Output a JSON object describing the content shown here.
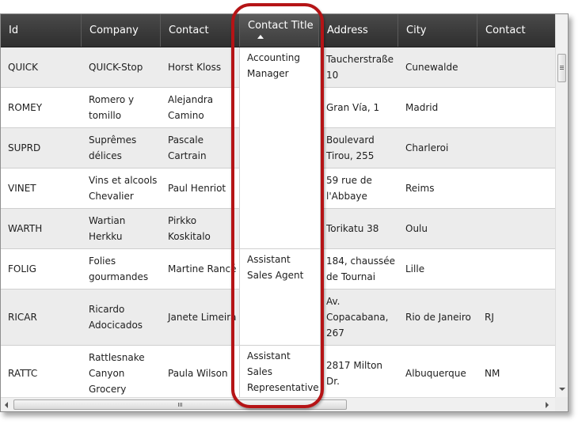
{
  "columns": [
    "Id",
    "Company",
    "Contact",
    "Contact Title",
    "Address",
    "City",
    "Contact"
  ],
  "rows": [
    {
      "id": "QUICK",
      "company": "QUICK-Stop",
      "contact": "Horst Kloss",
      "address": "Taucherstraße\n10",
      "city": "Cunewalde",
      "region": ""
    },
    {
      "id": "ROMEY",
      "company": "Romero y\ntomillo",
      "contact": "Alejandra\nCamino",
      "address": "Gran Vía, 1",
      "city": "Madrid",
      "region": ""
    },
    {
      "id": "SUPRD",
      "company": "Suprêmes\ndélices",
      "contact": "Pascale\nCartrain",
      "address": "Boulevard\nTirou, 255",
      "city": "Charleroi",
      "region": ""
    },
    {
      "id": "VINET",
      "company": "Vins et alcools\nChevalier",
      "contact": "Paul Henriot",
      "address": "59 rue de\nl'Abbaye",
      "city": "Reims",
      "region": ""
    },
    {
      "id": "WARTH",
      "company": "Wartian\nHerkku",
      "contact": "Pirkko\nKoskitalo",
      "address": "Torikatu 38",
      "city": "Oulu",
      "region": ""
    },
    {
      "id": "FOLIG",
      "company": "Folies\ngourmandes",
      "contact": "Martine Rancé",
      "address": "184, chaussée\nde Tournai",
      "city": "Lille",
      "region": ""
    },
    {
      "id": "RICAR",
      "company": "Ricardo\nAdocicados",
      "contact": "Janete Limeira",
      "address": "Av.\nCopacabana,\n267",
      "city": "Rio de Janeiro",
      "region": "RJ"
    },
    {
      "id": "RATTC",
      "company": "Rattlesnake\nCanyon\nGrocery",
      "contact": "Paula Wilson",
      "address": "2817 Milton\nDr.",
      "city": "Albuquerque",
      "region": "NM"
    }
  ],
  "title_groups": [
    "Accounting\nManager",
    "Assistant\nSales Agent",
    "Assistant\nSales\nRepresentative"
  ],
  "colors": {
    "header_bg": "#3a3a3a",
    "alt_row": "#ececec",
    "highlight_ring": "#b51416"
  },
  "sort": {
    "column": "Contact Title",
    "direction": "ascending"
  }
}
